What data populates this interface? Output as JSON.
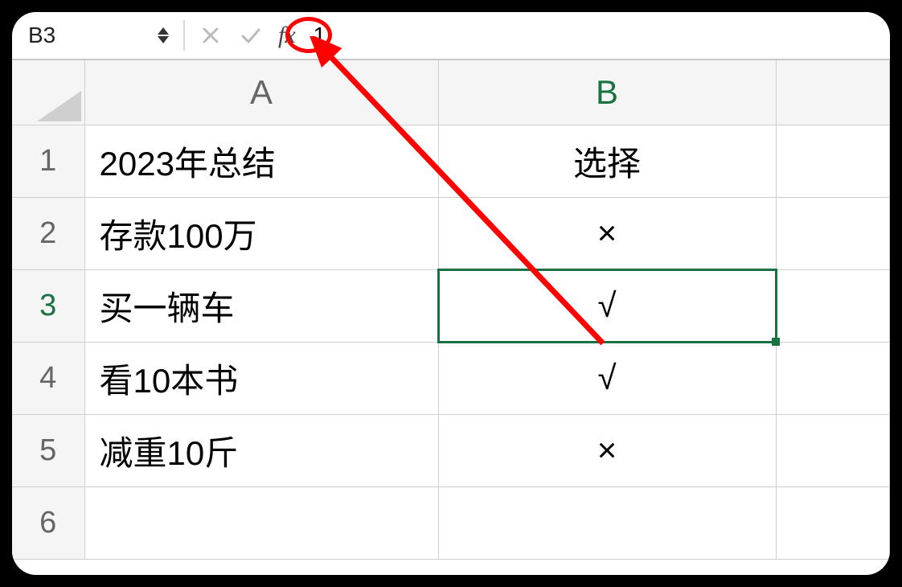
{
  "formula_bar": {
    "cell_ref": "B3",
    "fx_label": "fx",
    "value": "1"
  },
  "columns": [
    "A",
    "B"
  ],
  "active_cell": {
    "row": 3,
    "col": "B"
  },
  "rows": [
    {
      "n": "1",
      "a": "2023年总结",
      "b": "选择"
    },
    {
      "n": "2",
      "a": "存款100万",
      "b": "×"
    },
    {
      "n": "3",
      "a": "买一辆车",
      "b": "√"
    },
    {
      "n": "4",
      "a": "看10本书",
      "b": "√"
    },
    {
      "n": "5",
      "a": "减重10斤",
      "b": "×"
    },
    {
      "n": "6",
      "a": "",
      "b": ""
    }
  ]
}
